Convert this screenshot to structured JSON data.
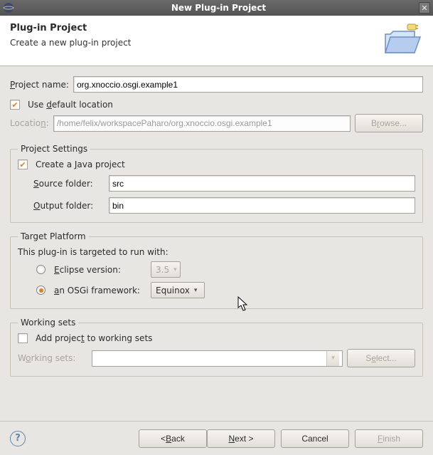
{
  "window": {
    "title": "New Plug-in Project"
  },
  "banner": {
    "heading": "Plug-in Project",
    "sub": "Create a new plug-in project"
  },
  "project_name": {
    "label_pre": "Project name:",
    "value": "org.xnoccio.osgi.example1"
  },
  "default_location": {
    "label": "Use default location"
  },
  "location": {
    "label": "Location:",
    "value": "/home/felix/workspacePaharo/org.xnoccio.osgi.example1",
    "browse": "Browse..."
  },
  "project_settings": {
    "legend": "Project Settings",
    "create_java": "Create a Java project",
    "source_label": "Source folder:",
    "source_value": "src",
    "output_label": "Output folder:",
    "output_value": "bin"
  },
  "target": {
    "legend": "Target Platform",
    "intro": "This plug-in is targeted to run with:",
    "eclipse_label": "Eclipse version:",
    "eclipse_value": "3.5",
    "osgi_label": "an OSGi framework:",
    "osgi_value": "Equinox"
  },
  "working_sets": {
    "legend": "Working sets",
    "add_label": "Add project to working sets",
    "list_label": "Working sets:",
    "select": "Select..."
  },
  "footer": {
    "back": "< Back",
    "next": "Next >",
    "cancel": "Cancel",
    "finish": "Finish"
  }
}
